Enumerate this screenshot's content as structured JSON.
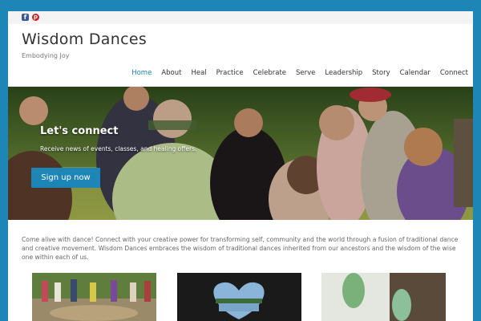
{
  "social": {
    "facebook_icon": "facebook-icon",
    "pinterest_icon": "pinterest-icon",
    "facebook_glyph": "f",
    "pinterest_glyph": "p"
  },
  "site": {
    "title": "Wisdom Dances",
    "tagline": "Embodying Joy"
  },
  "nav": {
    "items": [
      "Home",
      "About",
      "Heal",
      "Practice",
      "Celebrate",
      "Serve",
      "Leadership",
      "Story",
      "Calendar",
      "Connect"
    ],
    "active": "Home"
  },
  "hero": {
    "title": "Let's connect",
    "subtitle": "Receive news of events, classes, and healing offers.",
    "button_label": "Sign up now"
  },
  "intro": {
    "text": "Come alive with dance! Connect with your creative power for transforming self, community and the world through a fusion of traditional dance and creative movement. Wisdom Dances embraces the wisdom of traditional dances inherited from our ancestors and the wisdom of the wise one within each of us."
  },
  "colors": {
    "brand_blue": "#1e86b6",
    "title_text": "#333333"
  }
}
